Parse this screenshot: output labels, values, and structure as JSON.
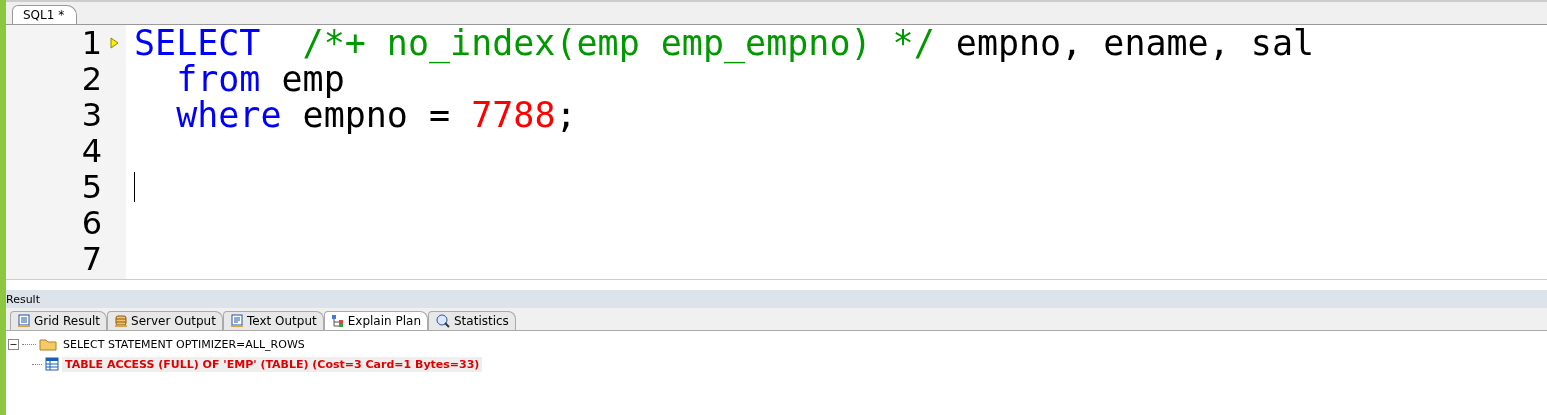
{
  "editor_tabs": [
    {
      "label": "SQL1 *",
      "selected": true
    }
  ],
  "code_lines": [
    {
      "number": "1",
      "current": true,
      "cursor": false,
      "tokens": [
        {
          "kind": "keyword",
          "text": "SELECT"
        },
        {
          "kind": "comment",
          "text": "  /*+ no_index(emp emp_empno) */"
        },
        {
          "kind": "plain",
          "text": " empno, ename, sal"
        }
      ]
    },
    {
      "number": "2",
      "current": false,
      "cursor": false,
      "tokens": [
        {
          "kind": "keyword",
          "text": "  from"
        },
        {
          "kind": "plain",
          "text": " emp"
        }
      ]
    },
    {
      "number": "3",
      "current": false,
      "cursor": false,
      "tokens": [
        {
          "kind": "keyword",
          "text": "  where"
        },
        {
          "kind": "plain",
          "text": " empno = "
        },
        {
          "kind": "number",
          "text": "7788"
        },
        {
          "kind": "plain",
          "text": ";"
        }
      ]
    },
    {
      "number": "4",
      "current": false,
      "cursor": false
    },
    {
      "number": "5",
      "current": false,
      "cursor": true
    },
    {
      "number": "6",
      "current": false,
      "cursor": false
    },
    {
      "number": "7",
      "current": false,
      "cursor": false
    }
  ],
  "result_panel": {
    "title": "Result",
    "tabs": [
      {
        "label": "Grid Result",
        "kind": "grid",
        "selected": false
      },
      {
        "label": "Server Output",
        "kind": "server",
        "selected": false
      },
      {
        "label": "Text Output",
        "kind": "text",
        "selected": false
      },
      {
        "label": "Explain Plan",
        "kind": "plan",
        "selected": true
      },
      {
        "label": "Statistics",
        "kind": "stats",
        "selected": false
      }
    ],
    "plan_tree": [
      {
        "text": "SELECT STATEMENT OPTIMIZER=ALL_ROWS",
        "kind": "folder",
        "expanded": true,
        "highlighted": false,
        "children": [
          {
            "text": "TABLE ACCESS (FULL) OF 'EMP' (TABLE) (Cost=3 Card=1 Bytes=33)",
            "kind": "table",
            "highlighted": true
          }
        ]
      }
    ]
  }
}
